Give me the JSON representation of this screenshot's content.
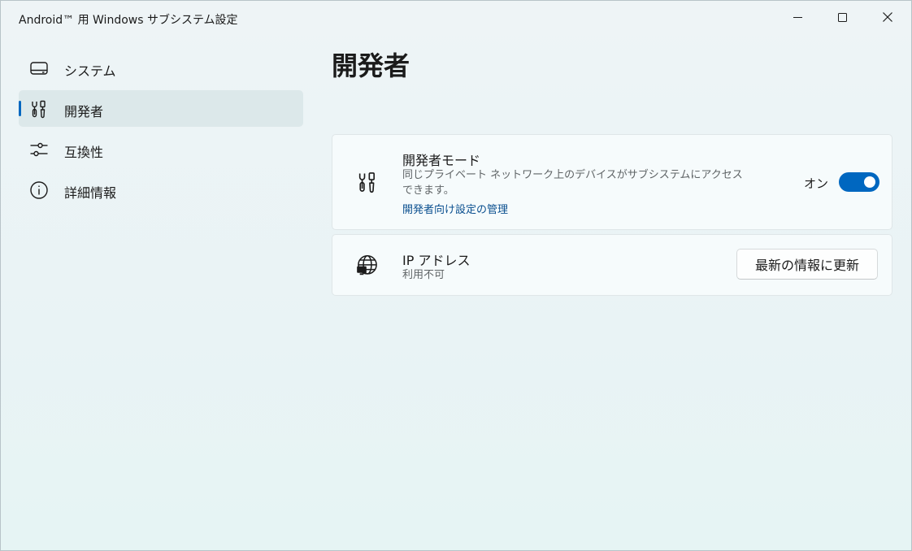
{
  "window": {
    "title": "Android™ 用 Windows サブシステム設定",
    "controls": [
      "minimize-icon",
      "maximize-icon",
      "close-icon"
    ]
  },
  "sidebar": {
    "items": [
      {
        "label": "システム",
        "icon": "system-display-icon",
        "selected": false
      },
      {
        "label": "開発者",
        "icon": "developer-tools-icon",
        "selected": true
      },
      {
        "label": "互換性",
        "icon": "sliders-icon",
        "selected": false
      },
      {
        "label": "詳細情報",
        "icon": "info-icon",
        "selected": false
      }
    ]
  },
  "main": {
    "page_title": "開発者",
    "developer_mode": {
      "icon": "developer-tools-icon",
      "title": "開発者モード",
      "description": "同じプライベート ネットワーク上のデバイスがサブシステムにアクセスできます。",
      "link": "開発者向け設定の管理",
      "toggle_label": "オン",
      "toggle_on": true
    },
    "ip_address": {
      "icon": "globe-network-icon",
      "title": "IP アドレス",
      "value": "利用不可",
      "button_label": "最新の情報に更新"
    }
  },
  "colors": {
    "accent": "#0067c0",
    "link": "#0a4f8f",
    "selected_nav_bg": "#dce8ea"
  }
}
